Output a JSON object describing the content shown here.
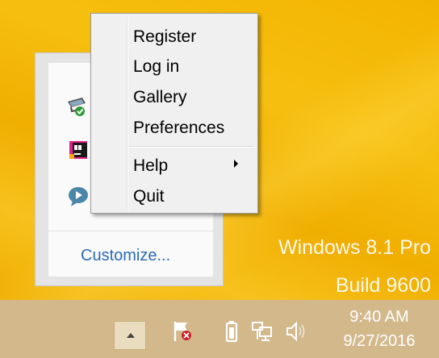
{
  "desktop": {
    "watermark_line1": "Windows 8.1 Pro",
    "watermark_line2": "Build 9600",
    "background_color": "#f3b400"
  },
  "tray_popup": {
    "icons": [
      "monitor-check-icon",
      "app-pink-icon",
      "chat-bubble-icon"
    ],
    "customize_link": "Customize..."
  },
  "context_menu": {
    "items": [
      {
        "label": "Register"
      },
      {
        "label": "Log in"
      },
      {
        "label": "Gallery"
      },
      {
        "label": "Preferences"
      },
      {
        "label": "Help",
        "has_submenu": true
      },
      {
        "label": "Quit"
      }
    ]
  },
  "taskbar": {
    "background_color": "#d2b88b",
    "tray_icons": [
      "show-hidden-icons-button",
      "action-center-flag-icon",
      "battery-icon",
      "network-icon",
      "volume-icon"
    ],
    "clock": {
      "time": "9:40 AM",
      "date": "9/27/2016"
    }
  }
}
